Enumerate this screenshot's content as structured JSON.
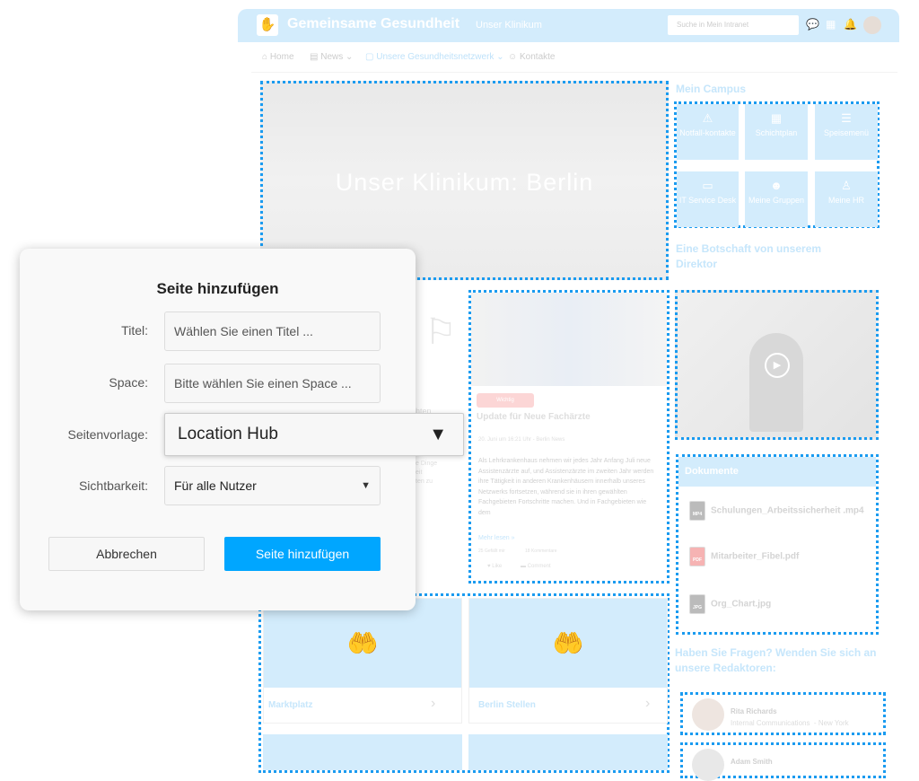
{
  "header": {
    "brand": "Gemeinsame Gesundheit",
    "subtitle": "Unser Klinikum",
    "search_placeholder": "Suche in Mein Intranet"
  },
  "nav": [
    {
      "label": "Home"
    },
    {
      "label": "News"
    },
    {
      "label": "Unsere Gesundheitsnetzwerk"
    },
    {
      "label": "Kontakte"
    }
  ],
  "hero": {
    "title": "Unser Klinikum: Berlin"
  },
  "campus": {
    "title": "Mein Campus",
    "tiles": [
      {
        "label": "Notfall-kontakte",
        "icon": "warning-icon"
      },
      {
        "label": "Schichtplan",
        "icon": "calendar-icon"
      },
      {
        "label": "Speisemenü",
        "icon": "burger-icon"
      },
      {
        "label": "IT Service Desk",
        "icon": "monitor-icon"
      },
      {
        "label": "Meine Gruppen",
        "icon": "group-icon"
      },
      {
        "label": "Meine HR",
        "icon": "person-icon"
      }
    ]
  },
  "director": {
    "title": "Eine Botschaft von unserem Direktor"
  },
  "news": {
    "badge": "Wichtig",
    "title": "Update für Neue Fachärzte",
    "meta": "20. Juni um 16:21 Uhr - Berlin News",
    "body": "Als Lehrkrankenhaus nehmen wir jedes Jahr Anfang Juli neue Assistenzärzte auf, und Assistenzärzte im zweiten Jahr werden ihre Tätigkeit in anderen Krankenhäusern innerhalb unseres Netzwerks fortsetzen, während sie in ihren gewählten Fachgebieten Fortschritte machen. Und in Fachgebieten wie dem",
    "more": "Mehr lesen »",
    "likes": "25 Gefällt mir",
    "comments": "18 Kommentare",
    "like": "Like",
    "comment": "Comment"
  },
  "left_card": {
    "fragments": [
      "hten",
      "e Dinge",
      "eit",
      "ten zu"
    ]
  },
  "documents": {
    "title": "Dokumente",
    "items": [
      {
        "name": "Schulungen_Arbeitssicherheit .mp4",
        "type": "MP4",
        "color": "#bbbbbb"
      },
      {
        "name": "Mitarbeiter_Fibel.pdf",
        "type": "PDF",
        "color": "#f6b3b3"
      },
      {
        "name": "Org_Chart.jpg",
        "type": "JPG",
        "color": "#bbbbbb"
      }
    ]
  },
  "editors": {
    "title": "Haben Sie Fragen? Wenden Sie sich an unsere Redaktoren:",
    "people": [
      {
        "name": "Rita Richards",
        "role": "Internal Communications  - New York"
      },
      {
        "name": "Adam Smith",
        "role": ""
      }
    ]
  },
  "bottom_tiles": [
    {
      "label": "Marktplatz"
    },
    {
      "label": "Berlin Stellen"
    }
  ],
  "modal": {
    "title": "Seite hinzufügen",
    "fields": {
      "title_label": "Titel:",
      "title_placeholder": "Wählen Sie einen Titel ...",
      "space_label": "Space:",
      "space_placeholder": "Bitte wählen Sie einen Space ...",
      "template_label": "Seitenvorlage:",
      "template_value": "Location Hub",
      "visibility_label": "Sichtbarkeit:",
      "visibility_value": "Für alle Nutzer"
    },
    "cancel": "Abbrechen",
    "submit": "Seite hinzufügen"
  },
  "colors": {
    "accent": "#00a6ff",
    "header_bg": "#d3ecfc",
    "dash": "#1a9bf0"
  }
}
